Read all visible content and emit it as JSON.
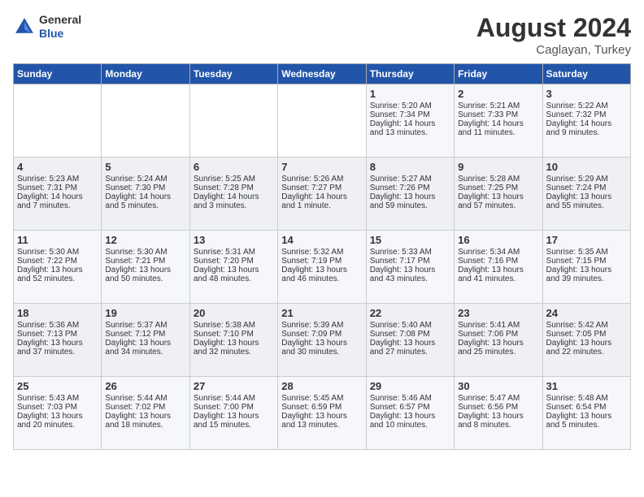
{
  "logo": {
    "general": "General",
    "blue": "Blue"
  },
  "header": {
    "month_year": "August 2024",
    "location": "Caglayan, Turkey"
  },
  "days_of_week": [
    "Sunday",
    "Monday",
    "Tuesday",
    "Wednesday",
    "Thursday",
    "Friday",
    "Saturday"
  ],
  "weeks": [
    [
      {
        "day": "",
        "data": ""
      },
      {
        "day": "",
        "data": ""
      },
      {
        "day": "",
        "data": ""
      },
      {
        "day": "",
        "data": ""
      },
      {
        "day": "1",
        "sunrise": "Sunrise: 5:20 AM",
        "sunset": "Sunset: 7:34 PM",
        "daylight": "Daylight: 14 hours and 13 minutes."
      },
      {
        "day": "2",
        "sunrise": "Sunrise: 5:21 AM",
        "sunset": "Sunset: 7:33 PM",
        "daylight": "Daylight: 14 hours and 11 minutes."
      },
      {
        "day": "3",
        "sunrise": "Sunrise: 5:22 AM",
        "sunset": "Sunset: 7:32 PM",
        "daylight": "Daylight: 14 hours and 9 minutes."
      }
    ],
    [
      {
        "day": "4",
        "sunrise": "Sunrise: 5:23 AM",
        "sunset": "Sunset: 7:31 PM",
        "daylight": "Daylight: 14 hours and 7 minutes."
      },
      {
        "day": "5",
        "sunrise": "Sunrise: 5:24 AM",
        "sunset": "Sunset: 7:30 PM",
        "daylight": "Daylight: 14 hours and 5 minutes."
      },
      {
        "day": "6",
        "sunrise": "Sunrise: 5:25 AM",
        "sunset": "Sunset: 7:28 PM",
        "daylight": "Daylight: 14 hours and 3 minutes."
      },
      {
        "day": "7",
        "sunrise": "Sunrise: 5:26 AM",
        "sunset": "Sunset: 7:27 PM",
        "daylight": "Daylight: 14 hours and 1 minute."
      },
      {
        "day": "8",
        "sunrise": "Sunrise: 5:27 AM",
        "sunset": "Sunset: 7:26 PM",
        "daylight": "Daylight: 13 hours and 59 minutes."
      },
      {
        "day": "9",
        "sunrise": "Sunrise: 5:28 AM",
        "sunset": "Sunset: 7:25 PM",
        "daylight": "Daylight: 13 hours and 57 minutes."
      },
      {
        "day": "10",
        "sunrise": "Sunrise: 5:29 AM",
        "sunset": "Sunset: 7:24 PM",
        "daylight": "Daylight: 13 hours and 55 minutes."
      }
    ],
    [
      {
        "day": "11",
        "sunrise": "Sunrise: 5:30 AM",
        "sunset": "Sunset: 7:22 PM",
        "daylight": "Daylight: 13 hours and 52 minutes."
      },
      {
        "day": "12",
        "sunrise": "Sunrise: 5:30 AM",
        "sunset": "Sunset: 7:21 PM",
        "daylight": "Daylight: 13 hours and 50 minutes."
      },
      {
        "day": "13",
        "sunrise": "Sunrise: 5:31 AM",
        "sunset": "Sunset: 7:20 PM",
        "daylight": "Daylight: 13 hours and 48 minutes."
      },
      {
        "day": "14",
        "sunrise": "Sunrise: 5:32 AM",
        "sunset": "Sunset: 7:19 PM",
        "daylight": "Daylight: 13 hours and 46 minutes."
      },
      {
        "day": "15",
        "sunrise": "Sunrise: 5:33 AM",
        "sunset": "Sunset: 7:17 PM",
        "daylight": "Daylight: 13 hours and 43 minutes."
      },
      {
        "day": "16",
        "sunrise": "Sunrise: 5:34 AM",
        "sunset": "Sunset: 7:16 PM",
        "daylight": "Daylight: 13 hours and 41 minutes."
      },
      {
        "day": "17",
        "sunrise": "Sunrise: 5:35 AM",
        "sunset": "Sunset: 7:15 PM",
        "daylight": "Daylight: 13 hours and 39 minutes."
      }
    ],
    [
      {
        "day": "18",
        "sunrise": "Sunrise: 5:36 AM",
        "sunset": "Sunset: 7:13 PM",
        "daylight": "Daylight: 13 hours and 37 minutes."
      },
      {
        "day": "19",
        "sunrise": "Sunrise: 5:37 AM",
        "sunset": "Sunset: 7:12 PM",
        "daylight": "Daylight: 13 hours and 34 minutes."
      },
      {
        "day": "20",
        "sunrise": "Sunrise: 5:38 AM",
        "sunset": "Sunset: 7:10 PM",
        "daylight": "Daylight: 13 hours and 32 minutes."
      },
      {
        "day": "21",
        "sunrise": "Sunrise: 5:39 AM",
        "sunset": "Sunset: 7:09 PM",
        "daylight": "Daylight: 13 hours and 30 minutes."
      },
      {
        "day": "22",
        "sunrise": "Sunrise: 5:40 AM",
        "sunset": "Sunset: 7:08 PM",
        "daylight": "Daylight: 13 hours and 27 minutes."
      },
      {
        "day": "23",
        "sunrise": "Sunrise: 5:41 AM",
        "sunset": "Sunset: 7:06 PM",
        "daylight": "Daylight: 13 hours and 25 minutes."
      },
      {
        "day": "24",
        "sunrise": "Sunrise: 5:42 AM",
        "sunset": "Sunset: 7:05 PM",
        "daylight": "Daylight: 13 hours and 22 minutes."
      }
    ],
    [
      {
        "day": "25",
        "sunrise": "Sunrise: 5:43 AM",
        "sunset": "Sunset: 7:03 PM",
        "daylight": "Daylight: 13 hours and 20 minutes."
      },
      {
        "day": "26",
        "sunrise": "Sunrise: 5:44 AM",
        "sunset": "Sunset: 7:02 PM",
        "daylight": "Daylight: 13 hours and 18 minutes."
      },
      {
        "day": "27",
        "sunrise": "Sunrise: 5:44 AM",
        "sunset": "Sunset: 7:00 PM",
        "daylight": "Daylight: 13 hours and 15 minutes."
      },
      {
        "day": "28",
        "sunrise": "Sunrise: 5:45 AM",
        "sunset": "Sunset: 6:59 PM",
        "daylight": "Daylight: 13 hours and 13 minutes."
      },
      {
        "day": "29",
        "sunrise": "Sunrise: 5:46 AM",
        "sunset": "Sunset: 6:57 PM",
        "daylight": "Daylight: 13 hours and 10 minutes."
      },
      {
        "day": "30",
        "sunrise": "Sunrise: 5:47 AM",
        "sunset": "Sunset: 6:56 PM",
        "daylight": "Daylight: 13 hours and 8 minutes."
      },
      {
        "day": "31",
        "sunrise": "Sunrise: 5:48 AM",
        "sunset": "Sunset: 6:54 PM",
        "daylight": "Daylight: 13 hours and 5 minutes."
      }
    ]
  ]
}
